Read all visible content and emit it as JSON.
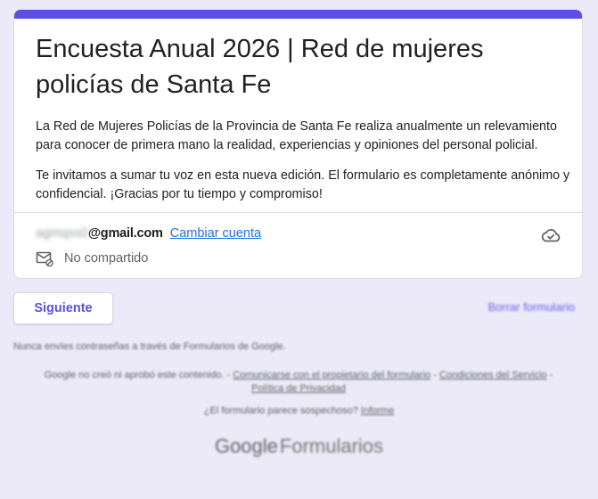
{
  "form": {
    "title": "Encuesta Anual 2026 | Red de mujeres policías de Santa Fe",
    "description_1": "La Red de Mujeres Policías de la Provincia de Santa Fe realiza anualmente un relevamiento para conocer de primera mano la realidad, experiencias y opiniones del personal policial.",
    "description_2": "Te invitamos a sumar tu voz en esta nueva edición. El formulario es completamente anónimo y confidencial. ¡Gracias por tu tiempo y compromiso!",
    "accent_color": "#5a4fe0"
  },
  "account": {
    "email_user": "agmqss0",
    "email_domain": "@gmail.com",
    "switch_label": "Cambiar cuenta",
    "share_status": "No compartido",
    "cloud_icon": "cloud-check-icon",
    "share_icon": "mail-not-shared-icon"
  },
  "actions": {
    "next_label": "Siguiente",
    "clear_label": "Borrar formulario"
  },
  "footer": {
    "password_warning": "Nunca envíes contraseñas a través de Formularios de Google.",
    "disclaimer_text": "Google no creó ni aprobó este contenido. -",
    "contact_owner": "Comunicarse con el propietario del formulario",
    "separator": "-",
    "terms": "Condiciones del Servicio",
    "privacy": "Política de Privacidad",
    "suspicious_text": "¿El formulario parece sospechoso?",
    "report_link": "Informe",
    "brand_google": "Google",
    "brand_product": "Formularios"
  }
}
